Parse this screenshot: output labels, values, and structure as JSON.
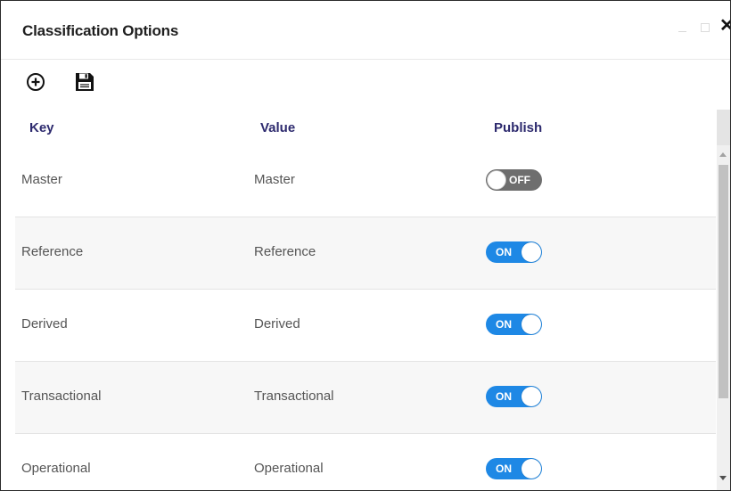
{
  "dialog": {
    "title": "Classification Options",
    "controls": {
      "close": "✕"
    }
  },
  "toolbar": {
    "items": [
      {
        "icon": "add-circle-icon"
      },
      {
        "icon": "save-icon"
      }
    ]
  },
  "table": {
    "columns": {
      "key": "Key",
      "value": "Value",
      "publish": "Publish"
    },
    "rows": [
      {
        "key": "Master",
        "value": "Master",
        "publish": "OFF"
      },
      {
        "key": "Reference",
        "value": "Reference",
        "publish": "ON"
      },
      {
        "key": "Derived",
        "value": "Derived",
        "publish": "ON"
      },
      {
        "key": "Transactional",
        "value": "Transactional",
        "publish": "ON"
      },
      {
        "key": "Operational",
        "value": "Operational",
        "publish": "ON"
      }
    ]
  },
  "colors": {
    "toggle_on": "#1e88e5",
    "toggle_off": "#6e6e6e",
    "header_text": "#2d2a6e"
  }
}
